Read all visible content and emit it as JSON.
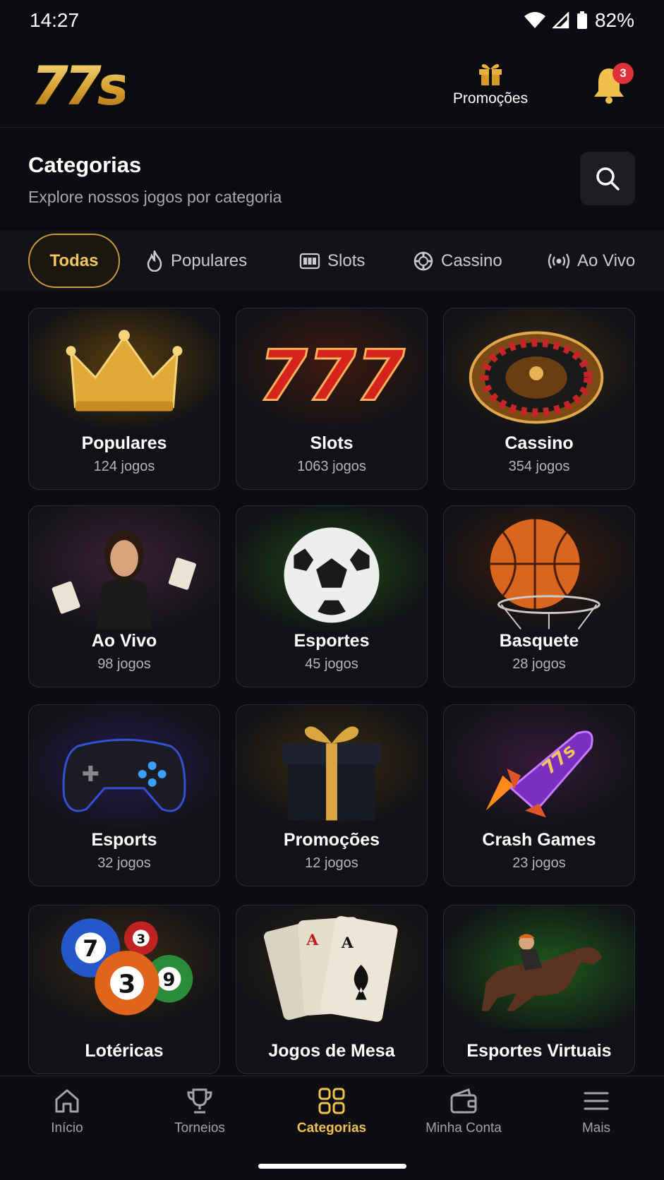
{
  "status_bar": {
    "time": "14:27",
    "battery": "82%"
  },
  "header": {
    "logo_text": "77s",
    "promo_label": "Promoções",
    "notifications_count": "3"
  },
  "section": {
    "title": "Categorias",
    "subtitle": "Explore nossos jogos por categoria"
  },
  "tabs": [
    {
      "label": "Todas",
      "icon": "none",
      "active": true
    },
    {
      "label": "Populares",
      "icon": "fire-icon"
    },
    {
      "label": "Slots",
      "icon": "slot-machine-icon"
    },
    {
      "label": "Cassino",
      "icon": "casino-chip-icon"
    },
    {
      "label": "Ao Vivo",
      "icon": "live-broadcast-icon"
    }
  ],
  "categories": [
    {
      "title": "Populares",
      "count": "124 jogos",
      "art": "crown"
    },
    {
      "title": "Slots",
      "count": "1063 jogos",
      "art": "777"
    },
    {
      "title": "Cassino",
      "count": "354 jogos",
      "art": "roulette"
    },
    {
      "title": "Ao Vivo",
      "count": "98 jogos",
      "art": "live-dealer"
    },
    {
      "title": "Esportes",
      "count": "45 jogos",
      "art": "soccer-ball"
    },
    {
      "title": "Basquete",
      "count": "28 jogos",
      "art": "basketball"
    },
    {
      "title": "Esports",
      "count": "32 jogos",
      "art": "gamepad"
    },
    {
      "title": "Promoções",
      "count": "12 jogos",
      "art": "gift-box"
    },
    {
      "title": "Crash Games",
      "count": "23 jogos",
      "art": "rocket"
    },
    {
      "title": "Lotéricas",
      "art": "lottery-balls"
    },
    {
      "title": "Jogos de Mesa",
      "art": "playing-cards"
    },
    {
      "title": "Esportes Virtuais",
      "art": "horse-racing"
    }
  ],
  "bottom_nav": [
    {
      "label": "Início",
      "icon": "home-icon"
    },
    {
      "label": "Torneios",
      "icon": "trophy-icon"
    },
    {
      "label": "Categorias",
      "icon": "grid-icon",
      "active": true
    },
    {
      "label": "Minha Conta",
      "icon": "wallet-icon"
    },
    {
      "label": "Mais",
      "icon": "menu-icon"
    }
  ],
  "colors": {
    "background": "#0b0c10",
    "accent_gold": "#f0c14f",
    "badge_red": "#e0313a"
  }
}
